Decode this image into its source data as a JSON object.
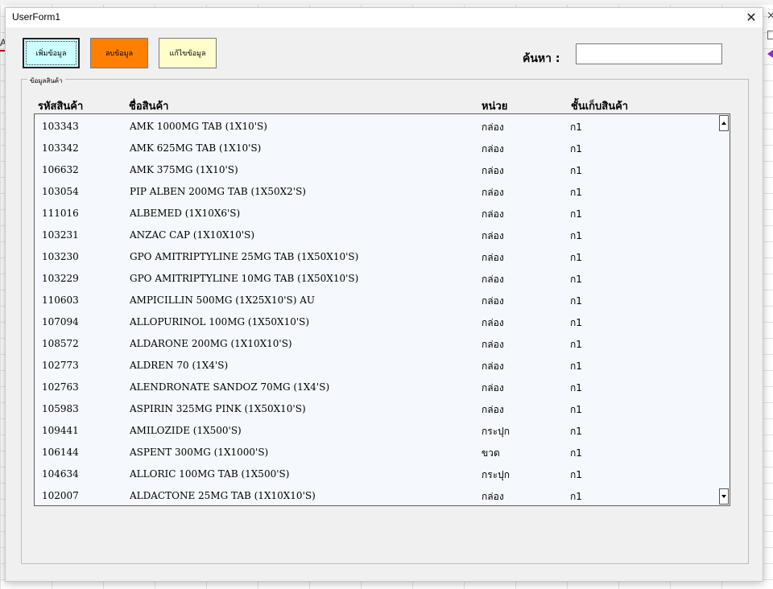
{
  "window": {
    "title": "UserForm1",
    "close_icon": "close-icon"
  },
  "toolbar": {
    "add_label": "เพิ่มข้อมูล",
    "delete_label": "ลบข้อมูล",
    "edit_label": "แก้ไขข้อมูล"
  },
  "search": {
    "label": "ค้นหา :",
    "value": ""
  },
  "frame": {
    "caption": "ข้อมูลสินค้า"
  },
  "columns": [
    "รหัสสินค้า",
    "ชื่อสินค้า",
    "หน่วย",
    "ชั้นเก็บสินค้า"
  ],
  "rows": [
    {
      "code": "103343",
      "name": "AMK 1000MG TAB (1X10'S)",
      "unit": "กล่อง",
      "shelf": "ก1"
    },
    {
      "code": "103342",
      "name": "AMK 625MG TAB (1X10'S)",
      "unit": "กล่อง",
      "shelf": "ก1"
    },
    {
      "code": "106632",
      "name": "AMK 375MG (1X10'S)",
      "unit": "กล่อง",
      "shelf": "ก1"
    },
    {
      "code": "103054",
      "name": "PIP ALBEN 200MG TAB (1X50X2'S)",
      "unit": "กล่อง",
      "shelf": "ก1"
    },
    {
      "code": "111016",
      "name": "ALBEMED (1X10X6'S)",
      "unit": "กล่อง",
      "shelf": "ก1"
    },
    {
      "code": "103231",
      "name": "ANZAC CAP (1X10X10'S)",
      "unit": "กล่อง",
      "shelf": "ก1"
    },
    {
      "code": "103230",
      "name": "GPO AMITRIPTYLINE 25MG TAB (1X50X10'S)",
      "unit": "กล่อง",
      "shelf": "ก1"
    },
    {
      "code": "103229",
      "name": "GPO AMITRIPTYLINE 10MG TAB (1X50X10'S)",
      "unit": "กล่อง",
      "shelf": "ก1"
    },
    {
      "code": "110603",
      "name": "AMPICILLIN 500MG (1X25X10'S) AU",
      "unit": "กล่อง",
      "shelf": "ก1"
    },
    {
      "code": "107094",
      "name": "ALLOPURINOL 100MG (1X50X10'S)",
      "unit": "กล่อง",
      "shelf": "ก1"
    },
    {
      "code": "108572",
      "name": "ALDARONE 200MG (1X10X10'S)",
      "unit": "กล่อง",
      "shelf": "ก1"
    },
    {
      "code": "102773",
      "name": "ALDREN 70 (1X4'S)",
      "unit": "กล่อง",
      "shelf": "ก1"
    },
    {
      "code": "102763",
      "name": "ALENDRONATE SANDOZ 70MG (1X4'S)",
      "unit": "กล่อง",
      "shelf": "ก1"
    },
    {
      "code": "105983",
      "name": "ASPIRIN 325MG PINK (1X50X10'S)",
      "unit": "กล่อง",
      "shelf": "ก1"
    },
    {
      "code": "109441",
      "name": "AMILOZIDE (1X500'S)",
      "unit": "กระปุก",
      "shelf": "ก1"
    },
    {
      "code": "106144",
      "name": "ASPENT 300MG (1X1000'S)",
      "unit": "ขวด",
      "shelf": "ก1"
    },
    {
      "code": "104634",
      "name": "ALLORIC 100MG TAB (1X500'S)",
      "unit": "กระปุก",
      "shelf": "ก1"
    },
    {
      "code": "102007",
      "name": "ALDACTONE 25MG TAB (1X10X10'S)",
      "unit": "กล่อง",
      "shelf": "ก1"
    }
  ],
  "colors": {
    "add_button": "#ccffff",
    "delete_button": "#ff8000",
    "edit_button": "#ffffcc",
    "form_background": "#f0f0f0",
    "list_background": "#f5f8fc"
  }
}
